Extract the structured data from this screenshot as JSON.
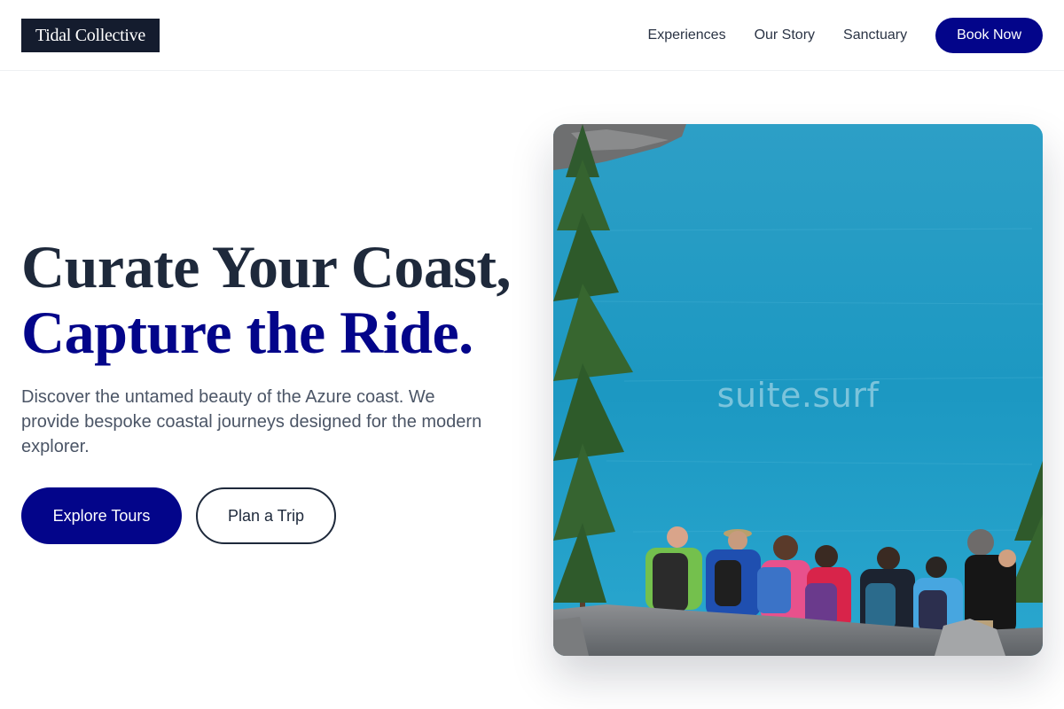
{
  "brand": {
    "logo_text": "Tidal Collective"
  },
  "nav": {
    "links": [
      "Experiences",
      "Our Story",
      "Sanctuary"
    ],
    "cta_label": "Book Now"
  },
  "hero": {
    "title_line1": "Curate Your Coast,",
    "title_line2": "Capture the Ride.",
    "subtitle": "Discover the untamed beauty of the Azure coast. We provide bespoke coastal journeys designed for the modern explorer.",
    "primary_cta": "Explore Tours",
    "secondary_cta": "Plan a Trip",
    "image_watermark": "suite.surf"
  },
  "colors": {
    "accent": "#03058a",
    "logo_bg": "#141c2e",
    "heading": "#1e293b",
    "lake": "#1d9cc4"
  }
}
